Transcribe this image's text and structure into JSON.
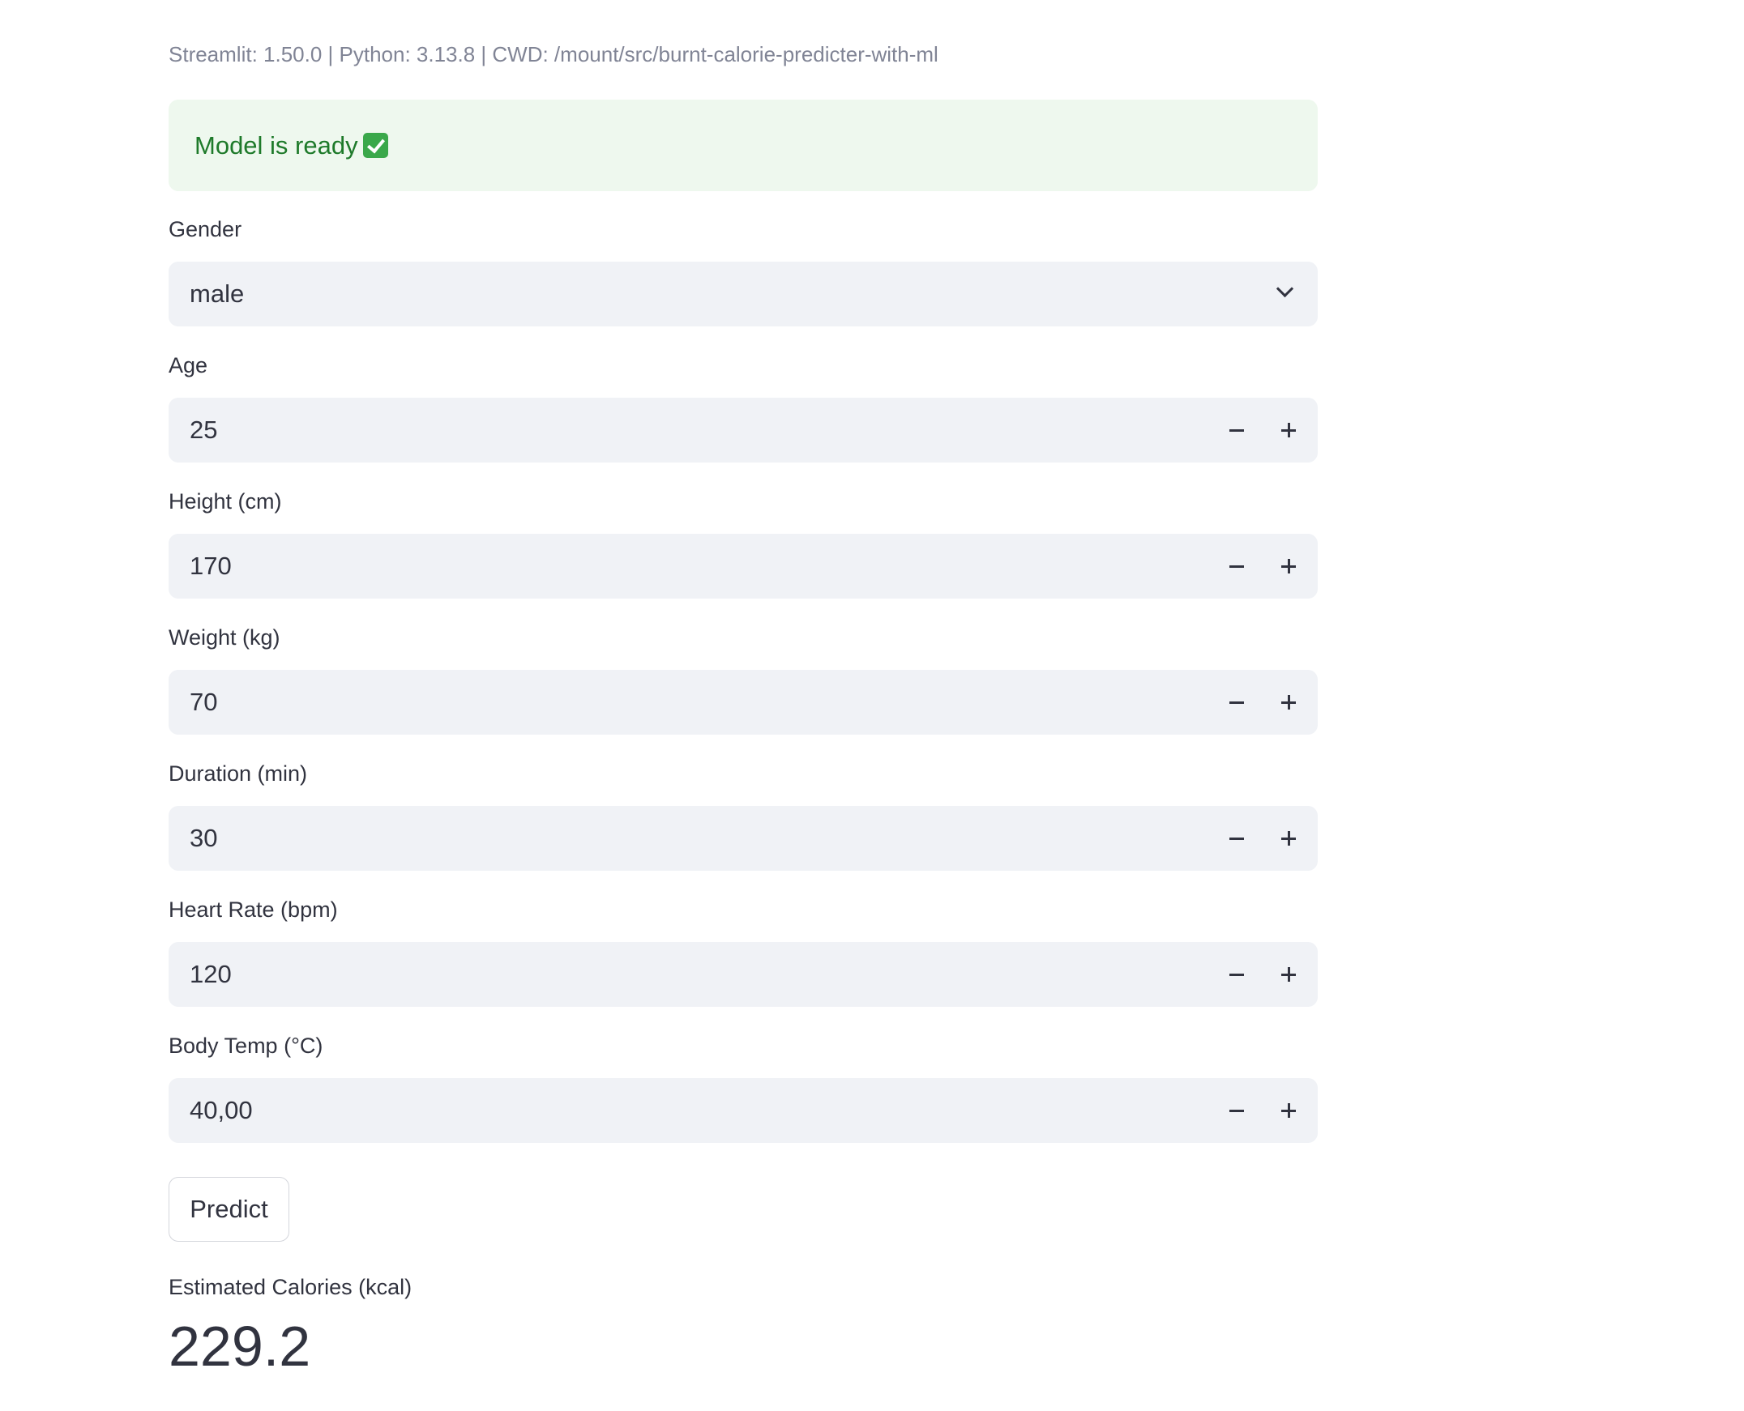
{
  "header": {
    "env_caption": "Streamlit: 1.50.0 | Python: 3.13.8 | CWD: /mount/src/burnt-calorie-predicter-with-ml"
  },
  "status": {
    "message": "Model is ready",
    "icon": "check-mark-icon"
  },
  "form": {
    "gender": {
      "label": "Gender",
      "value": "male",
      "icon": "chevron-down-icon"
    },
    "age": {
      "label": "Age",
      "value": "25"
    },
    "height": {
      "label": "Height (cm)",
      "value": "170"
    },
    "weight": {
      "label": "Weight (kg)",
      "value": "70"
    },
    "duration": {
      "label": "Duration (min)",
      "value": "30"
    },
    "heart_rate": {
      "label": "Heart Rate (bpm)",
      "value": "120"
    },
    "body_temp": {
      "label": "Body Temp (°C)",
      "value": "40,00"
    }
  },
  "actions": {
    "predict_label": "Predict"
  },
  "result": {
    "label": "Estimated Calories (kcal)",
    "value": "229.2"
  },
  "colors": {
    "success_bg": "#eef8ee",
    "success_text": "#1e7a2a",
    "input_bg": "#f0f2f6",
    "text": "#31333f",
    "caption": "#808495"
  }
}
